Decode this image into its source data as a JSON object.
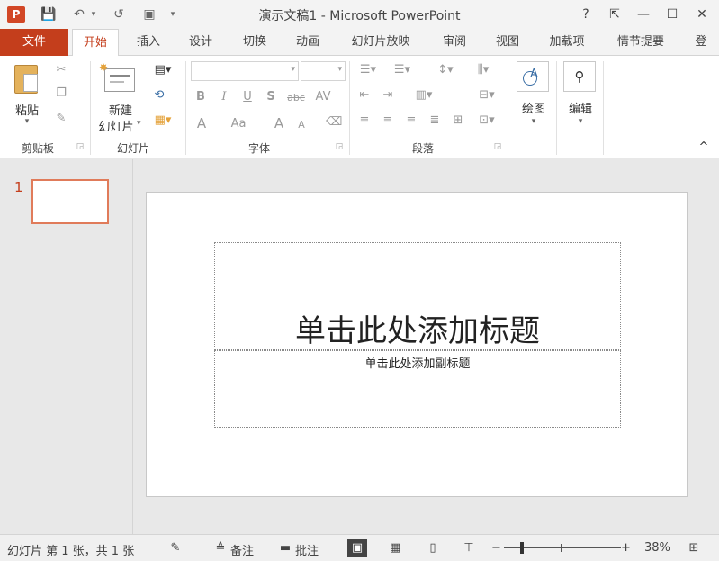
{
  "window": {
    "title": "演示文稿1 - Microsoft PowerPoint",
    "app_icon_letter": "P",
    "help": "?",
    "restore_ribbon": "⇱",
    "minimize": "—",
    "maximize": "☐",
    "close": "✕"
  },
  "qat": {
    "save": "💾",
    "undo": "↶",
    "undo_arrow": "▾",
    "redo": "↺",
    "start_from_beginning": "▣",
    "customize": "▾"
  },
  "tabs": {
    "file": "文件",
    "home": "开始",
    "insert": "插入",
    "design": "设计",
    "transitions": "切换",
    "animations": "动画",
    "slideshow": "幻灯片放映",
    "review": "审阅",
    "view": "视图",
    "addins": "加载项",
    "storyboard": "情节提要",
    "signin": "登"
  },
  "ribbon": {
    "clipboard": {
      "label": "剪贴板",
      "paste": "粘贴",
      "paste_arrow": "▾"
    },
    "slides": {
      "label": "幻灯片",
      "new_slide_line1": "新建",
      "new_slide_line2": "幻灯片",
      "new_slide_arrow": "▾"
    },
    "font": {
      "label": "字体",
      "bold": "B",
      "italic": "I",
      "underline": "U",
      "shadow": "S",
      "strike": "abc",
      "spacing": "AV",
      "font_color": "A",
      "change_case": "Aa",
      "grow": "A",
      "shrink": "A"
    },
    "paragraph": {
      "label": "段落"
    },
    "drawing": {
      "label": "绘图",
      "arrow": "▾"
    },
    "editing": {
      "label": "编辑",
      "arrow": "▾"
    },
    "collapse": "^"
  },
  "thumbnails": {
    "slide_number": "1"
  },
  "slide": {
    "title_placeholder": "单击此处添加标题",
    "subtitle_placeholder": "单击此处添加副标题"
  },
  "status": {
    "slide_info": "幻灯片 第 1 张，共 1 张",
    "notes": "备注",
    "comments": "批注",
    "zoom": 38,
    "zoom_label": "38%"
  }
}
